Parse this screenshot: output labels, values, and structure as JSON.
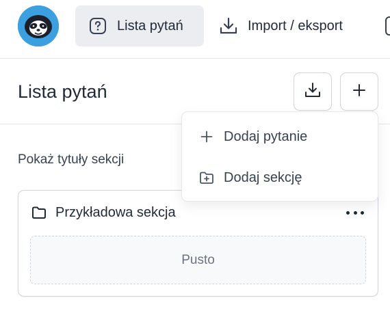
{
  "nav": {
    "items": [
      {
        "label": "Lista pytań",
        "icon": "question-square-icon",
        "active": true
      },
      {
        "label": "Import / eksport",
        "icon": "download-icon",
        "active": false
      }
    ]
  },
  "header": {
    "title": "Lista pytań",
    "buttons": [
      {
        "icon": "download-icon"
      },
      {
        "icon": "plus-icon"
      }
    ]
  },
  "dropdown": {
    "items": [
      {
        "label": "Dodaj pytanie",
        "icon": "plus-icon"
      },
      {
        "label": "Dodaj sekcję",
        "icon": "folder-plus-icon"
      }
    ]
  },
  "options": {
    "show_section_titles_label": "Pokaż tytuły sekcji"
  },
  "section": {
    "title": "Przykładowa sekcja",
    "empty_text": "Pusto"
  },
  "colors": {
    "logo_bg": "#3b9fe0",
    "active_nav_bg": "#ecedf0",
    "text": "#1f2937"
  }
}
